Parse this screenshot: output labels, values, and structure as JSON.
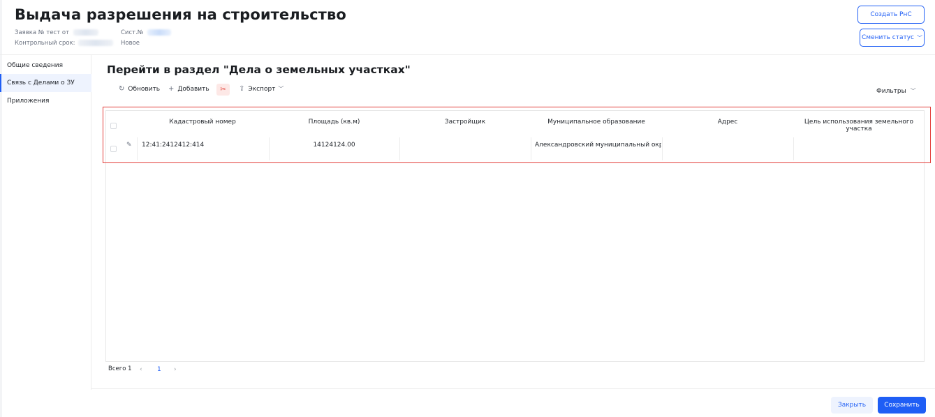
{
  "header": {
    "title": "Выдача разрешения на строительство",
    "request_label": "Заявка № тест от",
    "sys_label": "Сист.№",
    "deadline_label": "Контрольный срок:",
    "status": "Новое",
    "create_button": "Создать РнС",
    "change_status_button": "Сменить статус"
  },
  "sidebar": {
    "items": [
      {
        "label": "Общие сведения",
        "active": false
      },
      {
        "label": "Связь с Делами о ЗУ",
        "active": true
      },
      {
        "label": "Приложения",
        "active": false
      }
    ]
  },
  "main": {
    "section_title": "Перейти в раздел \"Дела о земельных участках\"",
    "toolbar": {
      "refresh": "Обновить",
      "add": "Добавить",
      "export": "Экспорт",
      "filters": "Фильтры"
    },
    "table": {
      "columns": [
        "Кадастровый номер",
        "Площадь (кв.м)",
        "Застройщик",
        "Муниципальное образование",
        "Адрес",
        "Цель использования земельного участка"
      ],
      "rows": [
        [
          "12:41:2412412:414",
          "14124124.00",
          "",
          "Александровский муниципальный округ",
          "",
          ""
        ]
      ]
    },
    "pagination": {
      "total_label": "Всего 1",
      "current_page": "1"
    }
  },
  "footer": {
    "close_button": "Закрыть",
    "save_button": "Сохранить"
  },
  "colors": {
    "accent": "#1f5ef5",
    "highlight_frame": "#e23c39",
    "delete_bg": "#fde8e6"
  },
  "icons": [
    "refresh-icon",
    "plus-icon",
    "delete-icon",
    "upload-icon",
    "chevron-down-icon",
    "edit-icon",
    "chevron-left-icon",
    "chevron-right-icon"
  ]
}
